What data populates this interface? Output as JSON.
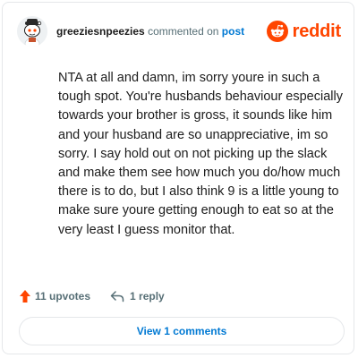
{
  "comment": {
    "username": "greeziesnpeezies",
    "action_text": "commented on",
    "post_link": "post",
    "body": "NTA at all and damn, im sorry youre in such a tough spot. You're husbands behaviour especially towards your brother is gross, it sounds like him and your husband are so unappreciative, im so sorry. I say hold out on not picking up the slack and make them see how much you do/how much there is to do, but I also think 9 is a little young to make sure youre getting enough to eat so at the very least I guess monitor that.",
    "upvotes_label": "11 upvotes",
    "reply_label": "1 reply",
    "view_comments_label": "View 1 comments"
  },
  "brand": {
    "wordmark": "reddit",
    "color": "#ff4500"
  },
  "colors": {
    "text": "#1c1c1c",
    "meta": "#576f76",
    "link": "#0079d3",
    "upvote": "#ff4500",
    "border": "#e5e7ea"
  },
  "icons": {
    "avatar": "snoo-avatar",
    "brand_logo": "reddit-logo-icon",
    "upvote": "upvote-arrow-icon",
    "reply": "reply-arrow-icon"
  }
}
